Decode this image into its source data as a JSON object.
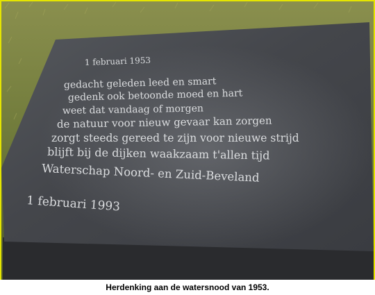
{
  "plaque": {
    "heading": "1 februari 1953",
    "lines": [
      "gedacht geleden leed en smart",
      "gedenk ook betoonde moed en hart",
      "weet dat vandaag of morgen",
      "de natuur voor nieuw gevaar kan zorgen",
      "zorgt steeds gereed te zijn voor nieuwe strijd",
      "blijft bij de dijken waakzaam t'allen tijd"
    ],
    "signature": "Waterschap Noord- en Zuid-Beveland",
    "date": "1 februari 1993"
  },
  "caption": "Herdenking aan de watersnood van 1953.",
  "colors": {
    "frame_border": "#e5e500",
    "grass": "#6f7c3a",
    "stone": "#3f4146",
    "engraving": "#e6e8ea"
  }
}
